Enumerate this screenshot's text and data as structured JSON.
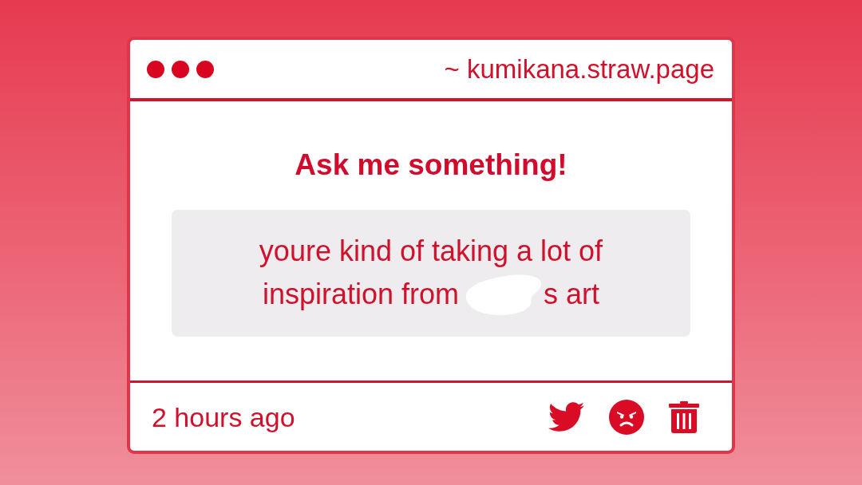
{
  "window": {
    "address": "~ kumikana.straw.page"
  },
  "prompt": {
    "title": "Ask me something!"
  },
  "question": {
    "lines": [
      "youre kind of taking a lot of",
      "inspiration from"
    ],
    "redaction": true,
    "after_redaction": "s art"
  },
  "footer": {
    "time": "2 hours ago"
  }
}
